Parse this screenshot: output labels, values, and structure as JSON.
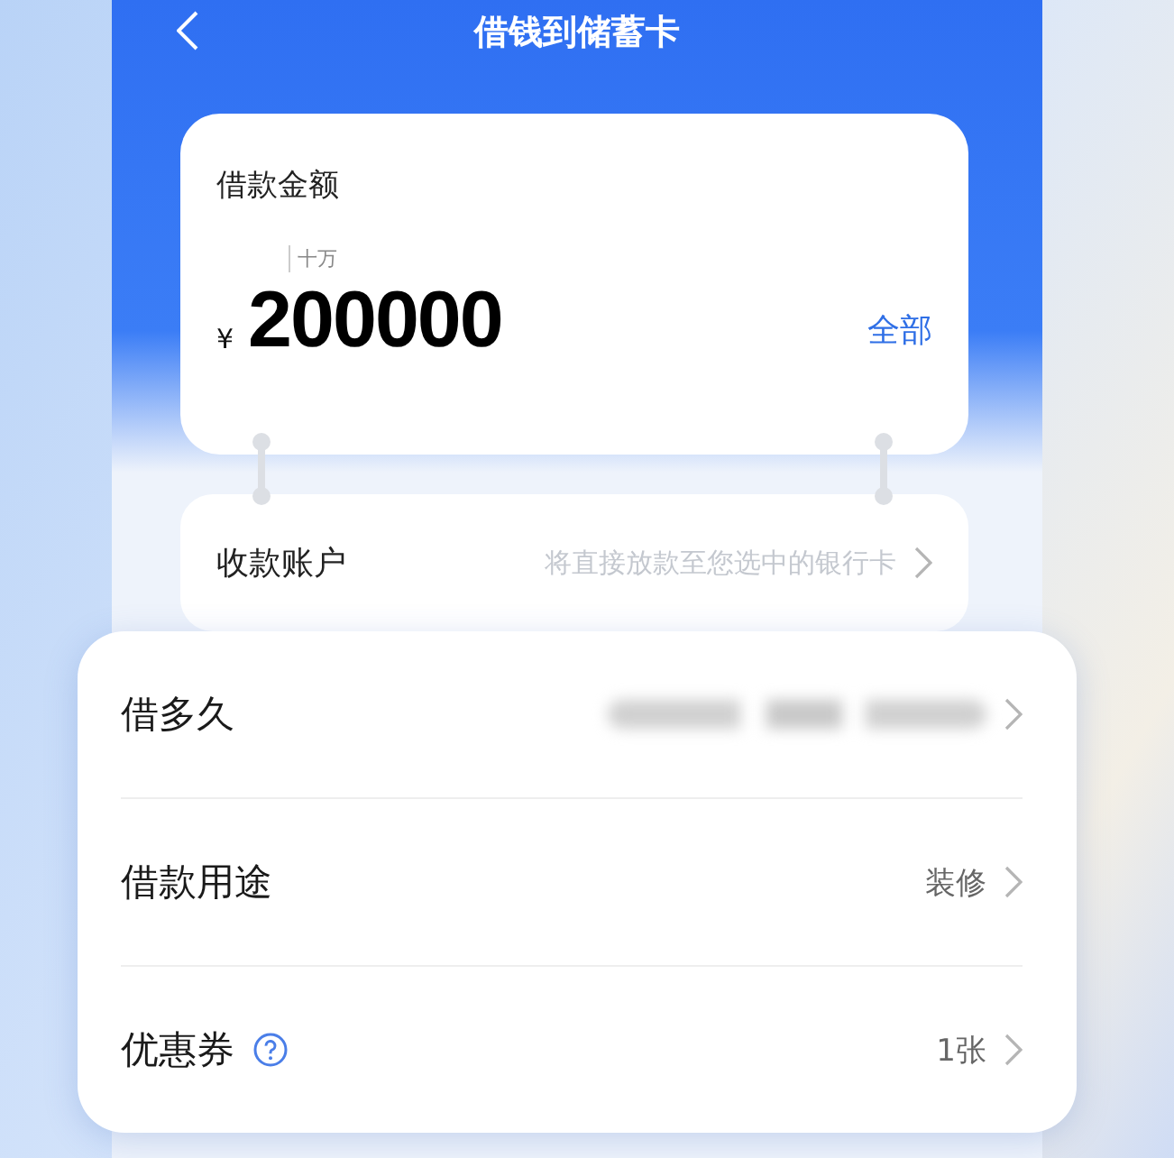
{
  "header": {
    "title": "借钱到储蓄卡"
  },
  "amount_card": {
    "label": "借款金额",
    "unit_hint": "十万",
    "currency": "¥",
    "amount": "200000",
    "all_button": "全部"
  },
  "account_row": {
    "label": "收款账户",
    "placeholder": "将直接放款至您选中的银行卡"
  },
  "options": [
    {
      "label": "借多久",
      "kind": "blurred",
      "has_help": false
    },
    {
      "label": "借款用途",
      "kind": "text",
      "value": "装修",
      "has_help": false
    },
    {
      "label": "优惠券",
      "kind": "text",
      "value": "1张",
      "has_help": true
    }
  ]
}
